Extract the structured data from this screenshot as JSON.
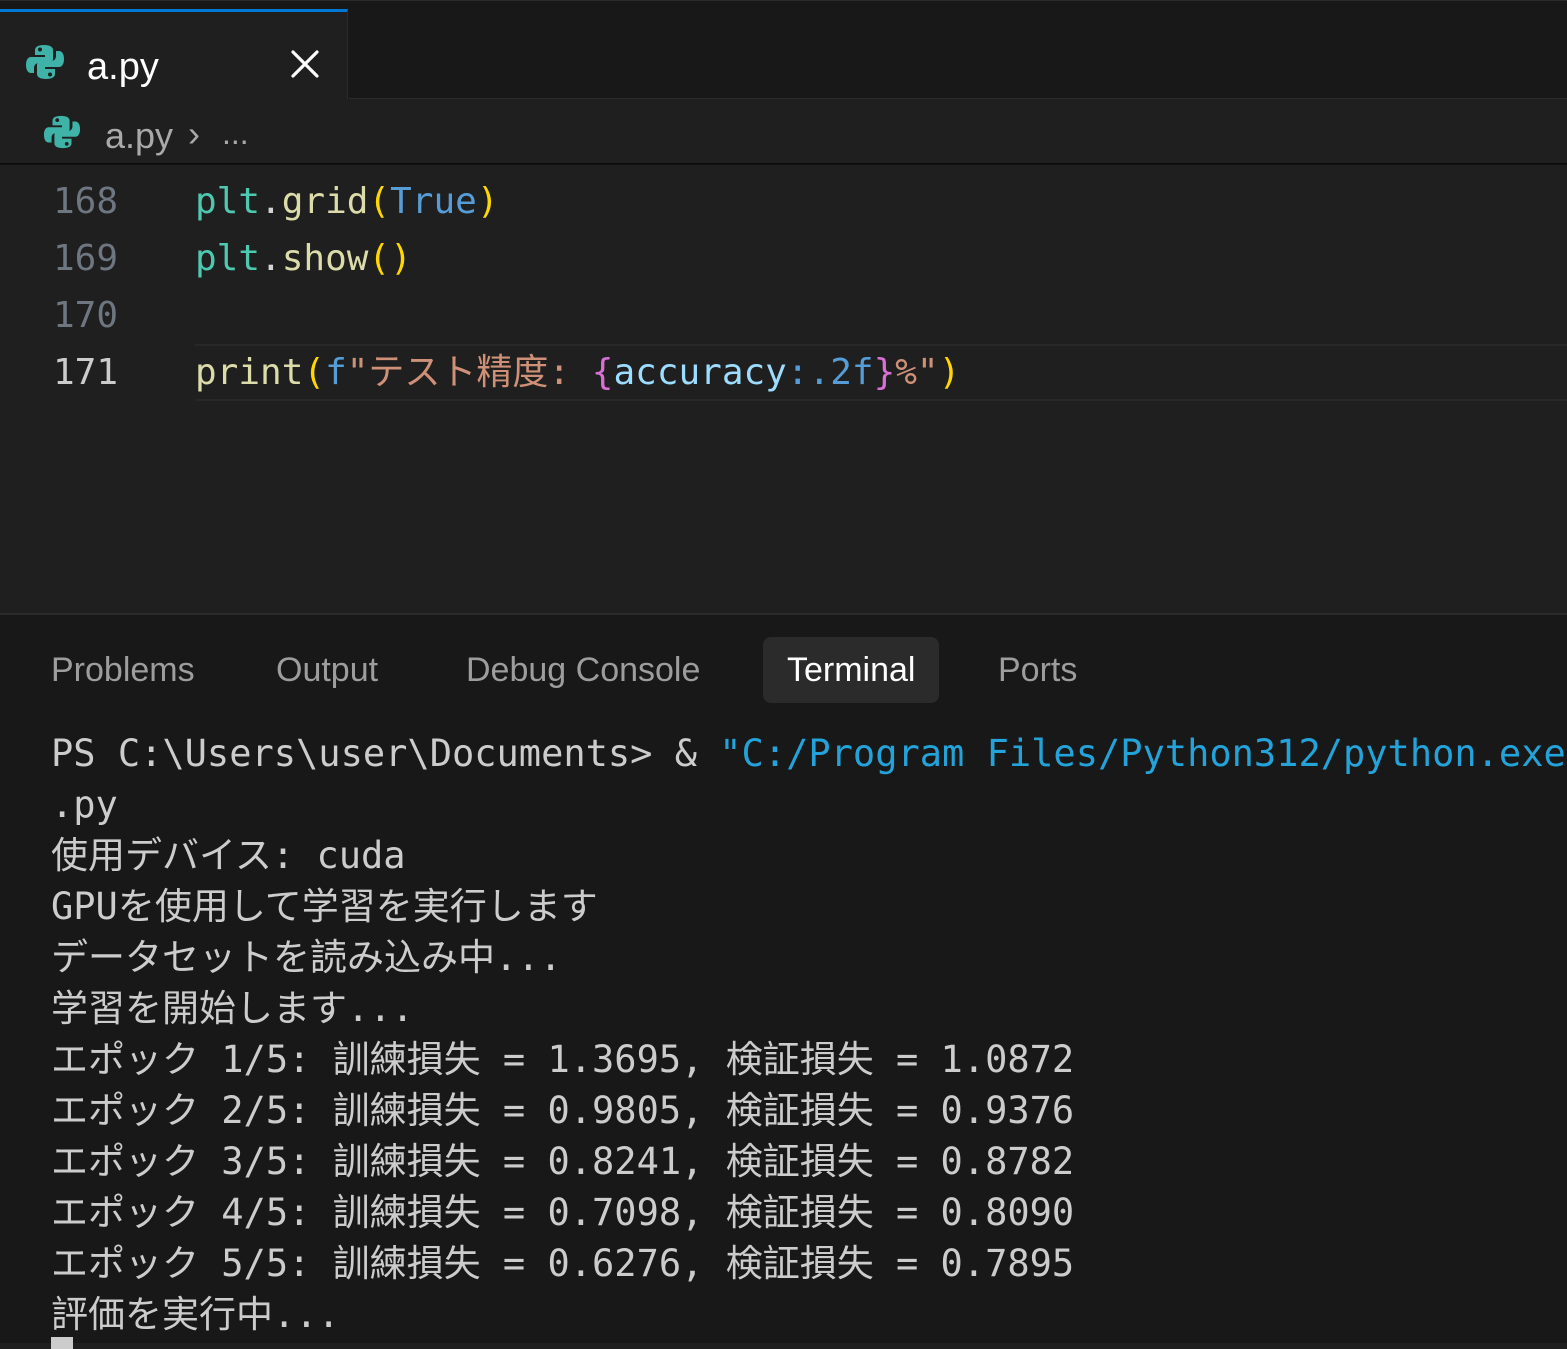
{
  "tab": {
    "label": "a.py"
  },
  "breadcrumb": {
    "file": "a.py",
    "separator": "›",
    "more": "..."
  },
  "editor": {
    "lines": [
      {
        "number": "168"
      },
      {
        "number": "169"
      },
      {
        "number": "170"
      },
      {
        "number": "171"
      }
    ],
    "code": {
      "l168": {
        "obj": "plt",
        "dot": ".",
        "fn": "grid",
        "open": "(",
        "arg": "True",
        "close": ")"
      },
      "l169": {
        "obj": "plt",
        "dot": ".",
        "fn": "show",
        "open": "(",
        "close": ")"
      },
      "l171": {
        "fn": "print",
        "open": "(",
        "prefix": "f",
        "str_start": "\"テスト精度: ",
        "brace_open": "{",
        "ident": "accuracy",
        "fmt": ":.2f",
        "brace_close": "}",
        "str_end": "%\"",
        "close": ")"
      }
    }
  },
  "panel": {
    "tabs": [
      "Problems",
      "Output",
      "Debug Console",
      "Terminal",
      "Ports"
    ],
    "active_tab": "Terminal"
  },
  "terminal": {
    "prompt": "PS C:\\Users\\user\\Documents> & ",
    "command_path": "\"C:/Program Files/Python312/python.exe\"",
    "lines": [
      ".py",
      "使用デバイス: cuda",
      "GPUを使用して学習を実行します",
      "データセットを読み込み中...",
      "学習を開始します...",
      "エポック 1/5: 訓練損失 = 1.3695, 検証損失 = 1.0872",
      "エポック 2/5: 訓練損失 = 0.9805, 検証損失 = 0.9376",
      "エポック 3/5: 訓練損失 = 0.8241, 検証損失 = 0.8782",
      "エポック 4/5: 訓練損失 = 0.7098, 検証損失 = 0.8090",
      "エポック 5/5: 訓練損失 = 0.6276, 検証損失 = 0.7895",
      "評価を実行中..."
    ]
  },
  "colors": {
    "accent": "#0078d4",
    "terminal_path": "#23a3d9",
    "python_icon": "#3fb3a8"
  }
}
